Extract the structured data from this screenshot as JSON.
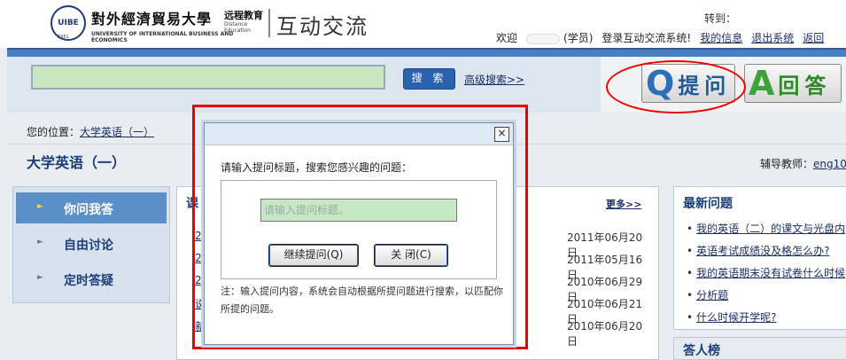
{
  "header": {
    "logo_short": "UIBE",
    "logo_year": "1951",
    "university_name": "對外經濟貿易大學",
    "distance": "远程教育",
    "distance_en": "Distance Education",
    "university_en": "UNIVERSITY OF INTERNATIONAL BUSINESS AND ECONOMICS",
    "app_title": "互动交流",
    "jump_label": "转到：",
    "welcome": "欢迎",
    "role": "(学员)",
    "login_msg": "登录互动交流系统!",
    "my_info": "我的信息",
    "logout": "退出系统",
    "back": "返回"
  },
  "search": {
    "placeholder": "",
    "button": "搜 索",
    "advanced": "高级搜索>>"
  },
  "qa_buttons": {
    "ask_letter": "Q",
    "ask_label": "提问",
    "answer_letter": "A",
    "answer_label": "回答"
  },
  "breadcrumb": {
    "label": "您的位置：",
    "course_link": "大学英语（一）"
  },
  "course_title": "大学英语（一）",
  "tutor": {
    "label": "辅导教师：",
    "name": "eng10"
  },
  "leftnav": [
    {
      "label": "你问我答"
    },
    {
      "label": "自由讨论"
    },
    {
      "label": "定时答疑"
    }
  ],
  "center": {
    "title": "课",
    "more": "更多>>",
    "rows": [
      {
        "title": "2",
        "date": "2011年06月20日"
      },
      {
        "title": "2",
        "date": "2011年05月16日"
      },
      {
        "title": "2",
        "date": "2010年06月29日"
      },
      {
        "title": "说",
        "date": "2010年06月21日"
      },
      {
        "title": "新",
        "date": "2010年06月20日"
      }
    ]
  },
  "latest": {
    "title": "最新问题",
    "items": [
      "我的英语（二）的课文与光盘内",
      "英语考试成绩没及格怎么办?",
      "我的英语期末没有试卷什么时候",
      "分析题",
      "什么时候开学呢?"
    ]
  },
  "rank_title": "答人榜",
  "dialog": {
    "close_icon": "×",
    "prompt": "请输入提问标题，搜索您感兴趣的问题：",
    "input_placeholder": "请输入提问标题。",
    "continue_btn": "继续提问(Q)",
    "close_btn": "关  闭(C)",
    "note": "注：输入提问内容，系统会自动根据所提问题进行搜索，以匹配你所提的问题。"
  },
  "colors": {
    "accent_blue": "#4a7fc1",
    "highlight_red": "#e00000",
    "input_green": "#c6e8c2"
  }
}
